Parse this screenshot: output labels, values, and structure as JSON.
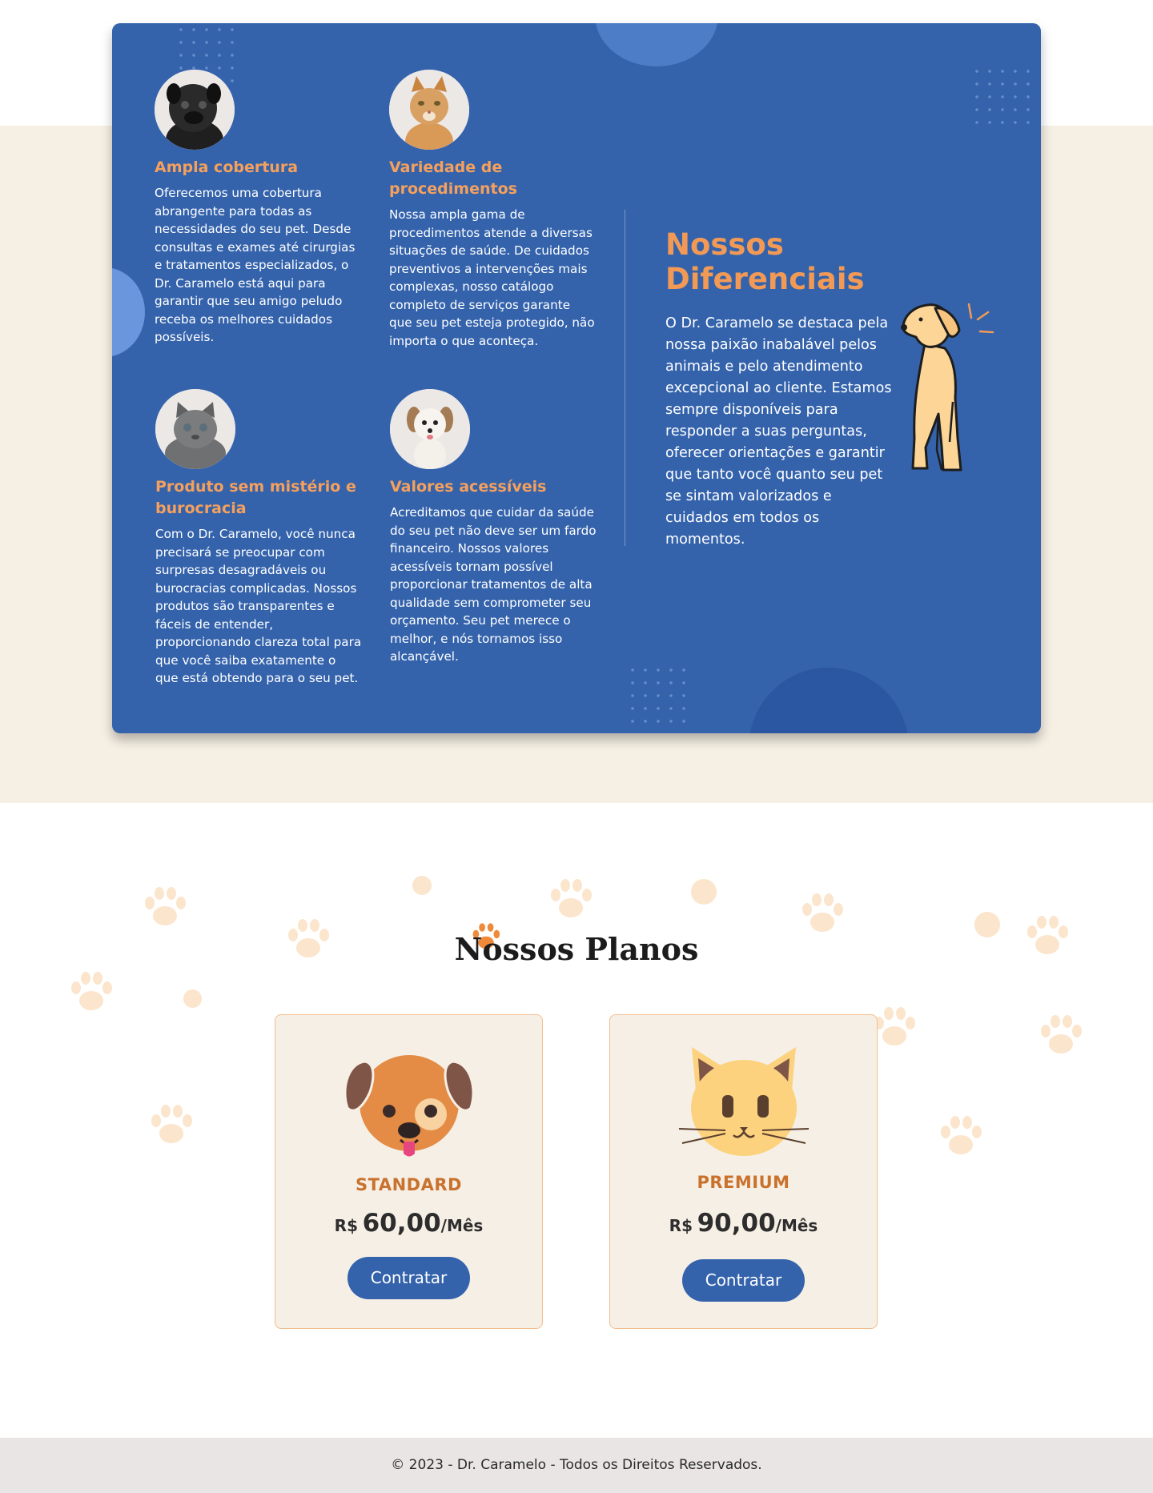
{
  "colors": {
    "primary_blue": "#3463ac",
    "accent_orange": "#f29a55",
    "beige": "#f5efe4",
    "paw_light": "#fbe5cc",
    "plan_name": "#c9722d",
    "footer_bg": "#e8e5e4"
  },
  "features": [
    {
      "title": "Ampla cobertura",
      "text": "Oferecemos uma cobertura abrangente para todas as necessidades do seu pet. Desde consultas e exames até cirurgias e tratamentos especializados, o Dr. Caramelo está aqui para garantir que seu amigo peludo receba os melhores cuidados possíveis.",
      "image": "black-pug-photo"
    },
    {
      "title": "Variedade de procedimentos",
      "text": "Nossa ampla gama de procedimentos atende a diversas situações de saúde. De cuidados preventivos a intervenções mais complexas, nosso catálogo completo de serviços garante que seu pet esteja protegido, não importa o que aconteça.",
      "image": "orange-tabby-cat-photo"
    },
    {
      "title": "Produto sem mistério e burocracia",
      "text": "Com o Dr. Caramelo, você nunca precisará se preocupar com surpresas desagradáveis ou burocracias complicadas. Nossos produtos são transparentes e fáceis de entender, proporcionando clareza total para que você saiba exatamente o que está obtendo para o seu pet.",
      "image": "gray-kitten-photo"
    },
    {
      "title": "Valores acessíveis",
      "text": "Acreditamos que cuidar da saúde do seu pet não deve ser um fardo financeiro. Nossos valores acessíveis tornam possível proporcionar tratamentos de alta qualidade sem comprometer seu orçamento. Seu pet merece o melhor, e nós tornamos isso alcançável.",
      "image": "white-puppy-photo"
    }
  ],
  "diferenciais": {
    "title": "Nossos Diferenciais",
    "text": "O Dr. Caramelo se destaca pela nossa paixão inabalável pelos animais e pelo atendimento excepcional ao cliente. Estamos sempre disponíveis para responder a suas perguntas, oferecer orientações e garantir que tanto você quanto seu pet se sintam valorizados e cuidados em todos os momentos.",
    "illustration": "caramel-dog-illustration"
  },
  "plans": {
    "title": "Nossos Planos",
    "items": [
      {
        "name": "STANDARD",
        "currency": "R$",
        "price": "60,00",
        "period": "/Mês",
        "button": "Contratar",
        "icon": "dog-face-icon"
      },
      {
        "name": "PREMIUM",
        "currency": "R$",
        "price": "90,00",
        "period": "/Mês",
        "button": "Contratar",
        "icon": "cat-face-icon"
      }
    ]
  },
  "footer": {
    "text": "© 2023 - Dr. Caramelo - Todos os Direitos Reservados."
  }
}
